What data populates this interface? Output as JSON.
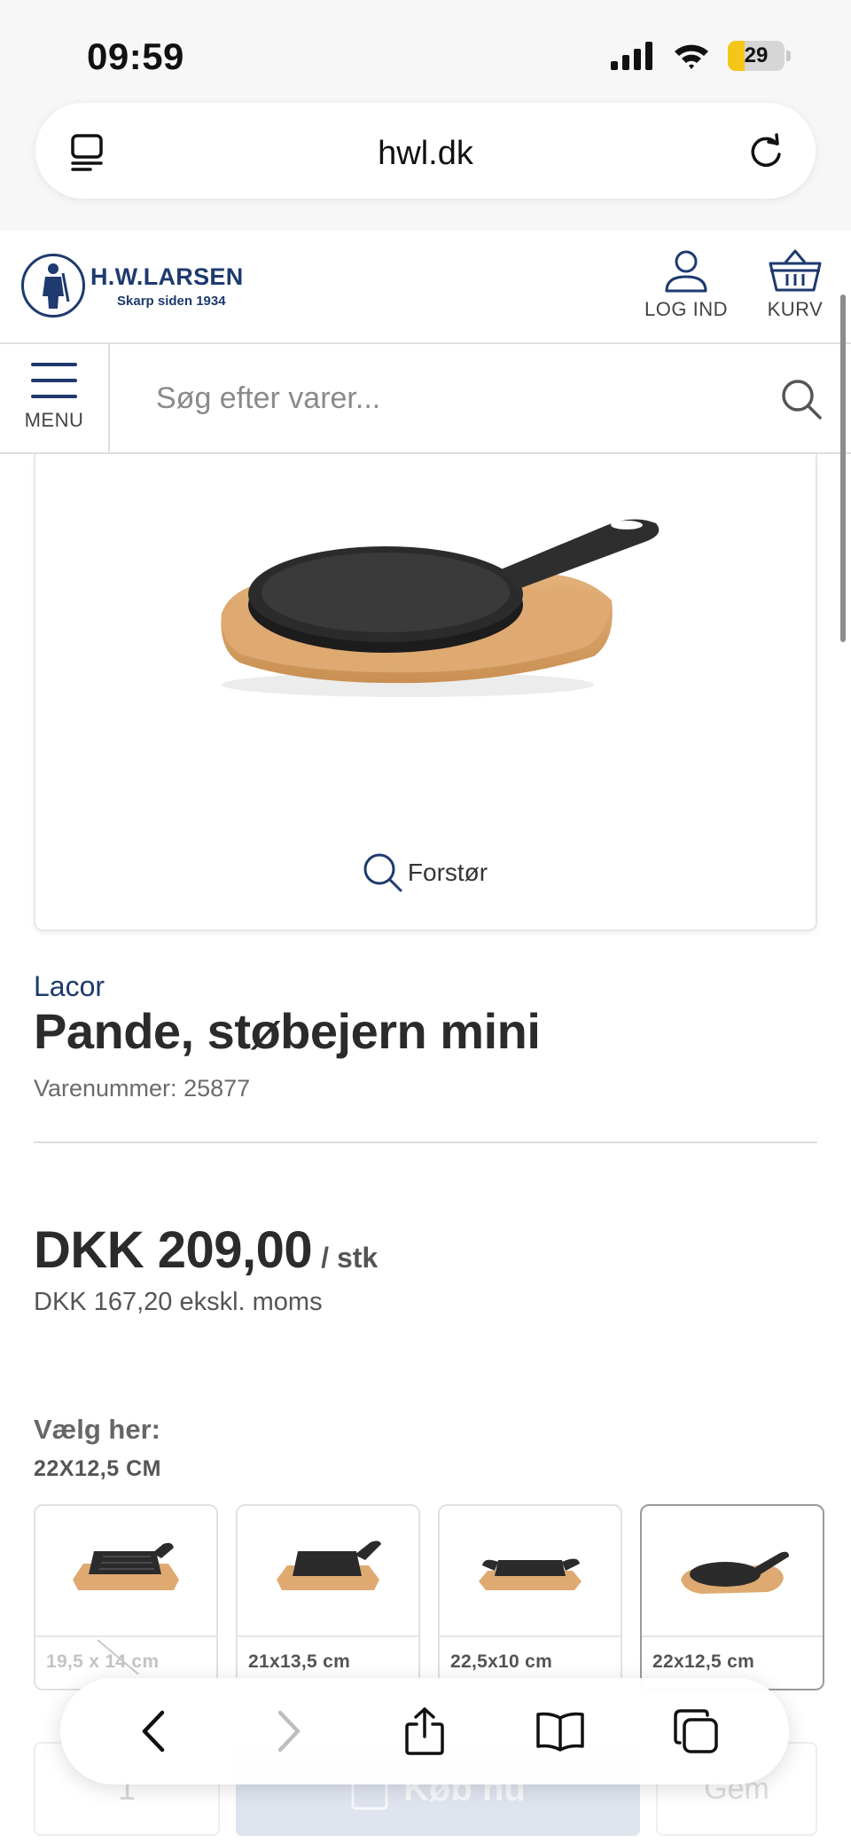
{
  "status_bar": {
    "time": "09:59",
    "battery_level": "29",
    "battery_fraction": 0.29
  },
  "browser": {
    "url": "hwl.dk"
  },
  "header": {
    "logo_name": "H.W.LARSEN",
    "logo_tagline": "Skarp siden 1934",
    "login_label": "LOG IND",
    "cart_label": "KURV"
  },
  "search": {
    "menu_label": "MENU",
    "placeholder": "Søg efter varer..."
  },
  "product": {
    "zoom_label": "Forstør",
    "brand": "Lacor",
    "title": "Pande, støbejern mini",
    "sku_label": "Varenummer:",
    "sku_value": "25877",
    "price": "DKK 209,00",
    "price_unit": "/ stk",
    "price_ex_vat": "DKK 167,20 ekskl. moms"
  },
  "variants": {
    "choose_label": "Vælg her:",
    "selected_value": "22X12,5 CM",
    "items": [
      {
        "label": "19,5 x 14 cm",
        "status": "sold-out"
      },
      {
        "label": "21x13,5 cm",
        "status": "available"
      },
      {
        "label": "22,5x10 cm",
        "status": "available"
      },
      {
        "label": "22x12,5 cm",
        "status": "selected"
      }
    ]
  },
  "buy_bar": {
    "quantity": "1",
    "buy_label": "Køb nu",
    "save_label": "Gem"
  },
  "colors": {
    "brand_blue": "#1e3a6e",
    "battery_yellow": "#f5c518",
    "text_dark": "#2b2b2b"
  }
}
